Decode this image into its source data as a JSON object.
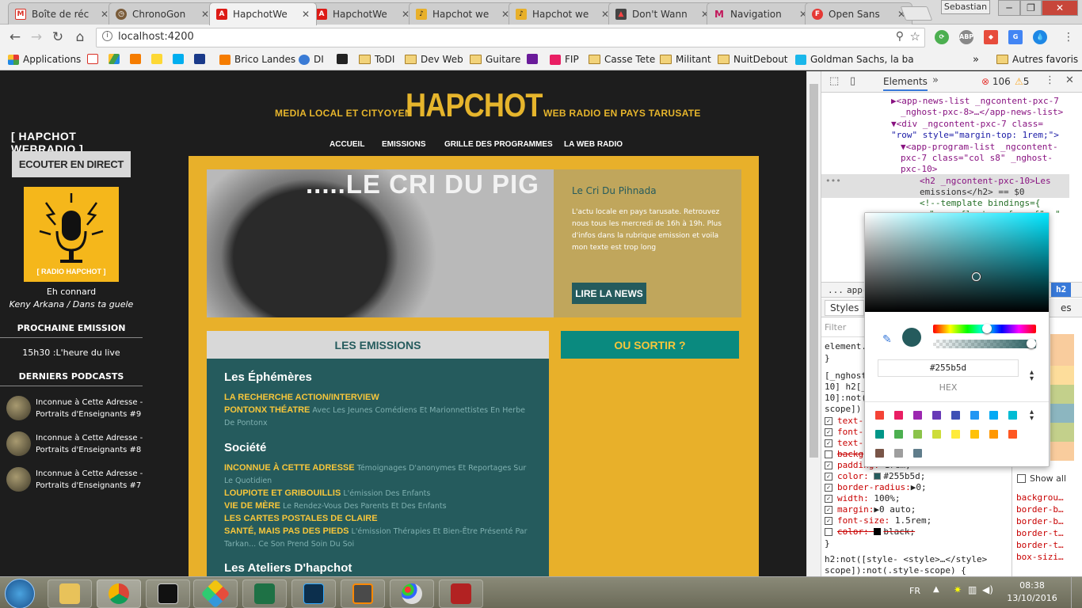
{
  "browser": {
    "tabs": [
      {
        "title": "Boîte de réc",
        "favicon": "gmail-icon",
        "color": "#d93025"
      },
      {
        "title": "ChronoGon",
        "favicon": "chrono-icon",
        "color": "#7a5c3a"
      },
      {
        "title": "HapchotWe",
        "favicon": "angular-icon",
        "color": "#dd1b16"
      },
      {
        "title": "HapchotWe",
        "favicon": "angular-icon",
        "color": "#dd1b16"
      },
      {
        "title": "Hapchot we",
        "favicon": "mic-icon",
        "color": "#e8b02a"
      },
      {
        "title": "Hapchot we",
        "favicon": "mic-icon",
        "color": "#e8b02a"
      },
      {
        "title": "Don't Wann",
        "favicon": "chart-icon",
        "color": "#444"
      },
      {
        "title": "Navigation",
        "favicon": "m-icon",
        "color": "#c2185b"
      },
      {
        "title": "Open Sans",
        "favicon": "f-icon",
        "color": "#e53935"
      }
    ],
    "active_tab": 2,
    "user": "Sebastian",
    "url": "localhost:4200",
    "bookmarks": [
      {
        "label": "Applications",
        "type": "apps"
      },
      {
        "label": "",
        "type": "gmail"
      },
      {
        "label": "",
        "type": "drive"
      },
      {
        "label": "",
        "type": "box"
      },
      {
        "label": "",
        "type": "mc"
      },
      {
        "label": "",
        "type": "blabla"
      },
      {
        "label": "",
        "type": "upr"
      },
      {
        "label": "Brico Landes",
        "type": "box"
      },
      {
        "label": "DI",
        "type": "globe"
      },
      {
        "label": "",
        "type": "zt"
      },
      {
        "label": "ToDI",
        "type": "folder"
      },
      {
        "label": "Dev Web",
        "type": "folder"
      },
      {
        "label": "Guitare",
        "type": "folder"
      },
      {
        "label": "",
        "type": "mail"
      },
      {
        "label": "FIP",
        "type": "fip"
      },
      {
        "label": "Casse Tete",
        "type": "folder"
      },
      {
        "label": "Militant",
        "type": "folder"
      },
      {
        "label": "NuitDebout",
        "type": "folder"
      },
      {
        "label": "Goldman Sachs, la ba",
        "type": "vimeo"
      },
      {
        "label": "Autres favoris",
        "type": "folder"
      }
    ]
  },
  "site": {
    "sidebar": {
      "title": "[ HAPCHOT WEBRADIO ]",
      "listen_button": "ECOUTER EN DIRECT",
      "logo_label": "[ RADIO HAPCHOT ]",
      "now_playing_title": "Eh connard",
      "now_playing_artist": "Keny Arkana / Dans ta guele",
      "next_heading": "PROCHAINE EMISSION",
      "next_show": "15h30 :L'heure du live",
      "podcasts_heading": "DERNIERS PODCASTS",
      "podcasts": [
        "Inconnue à Cette Adresse - Portraits d'Enseignants #9",
        "Inconnue à Cette Adresse - Portraits d'Enseignants #8",
        "Inconnue à Cette Adresse - Portraits d'Enseignants #7"
      ]
    },
    "header": {
      "tagline_left": "MEDIA LOCAL ET CITYOYEN",
      "title": "HAPCHOT",
      "tagline_right": "WEB RADIO EN PAYS TARUSATE"
    },
    "menu": [
      "ACCUEIL",
      "EMISSIONS",
      "GRILLE DES PROGRAMMES",
      "LA WEB RADIO"
    ],
    "news": {
      "image_caption": ".....LE CRI DU PIG",
      "title": "Le Cri Du Pihnada",
      "description": "L'actu locale en pays tarusate. Retrouvez nous tous les mercredi de 16h à 19h. Plus d'infos dans la rubrique emission et voila mon texte est trop long",
      "button": "LIRE LA NEWS"
    },
    "emissions": {
      "heading": "LES EMISSIONS",
      "categories": [
        {
          "name": "Les Éphémères",
          "programs": [
            {
              "name": "LA RECHERCHE ACTION/INTERVIEW",
              "desc": ""
            },
            {
              "name": "PONTONX THÉATRE",
              "desc": "Avec Les Jeunes Comédiens Et Marionnettistes En Herbe De Pontonx"
            }
          ]
        },
        {
          "name": "Société",
          "programs": [
            {
              "name": "INCONNUE À CETTE ADRESSE",
              "desc": "Témoignages D'anonymes Et Reportages Sur Le Quotidien"
            },
            {
              "name": "LOUPIOTE ET GRIBOUILLIS",
              "desc": "L'émission Des Enfants"
            },
            {
              "name": "VIE DE MÈRE",
              "desc": "Le Rendez-Vous Des Parents Et Des Enfants"
            },
            {
              "name": "LES CARTES POSTALES DE CLAIRE",
              "desc": ""
            },
            {
              "name": "SANTÉ, MAIS PAS DES PIEDS",
              "desc": "L'émission Thérapies Et Bien-Être Présenté Par Tarkan... Ce Son Prend Soin Du Soi"
            }
          ]
        },
        {
          "name": "Les Ateliers D'hapchot",
          "programs": []
        }
      ]
    },
    "out_heading": "OU SORTIR ?"
  },
  "devtools": {
    "tab": "Elements",
    "errors": "106",
    "warnings": "5",
    "dom_lines": [
      "▶<app-news-list _ngcontent-pxc-7",
      "_nghost-pxc-8>…</app-news-list>",
      "▼<div _ngcontent-pxc-7 class=",
      "\"row\" style=\"margin-top: 1rem;\">",
      "▼<app-program-list _ngcontent-",
      "pxc-7 class=\"col s8\" _nghost-",
      "pxc-10>",
      "<h2 _ngcontent-pxc-10>Les",
      "emissions</h2> == $0",
      "<!--template bindings={",
      "\"ng-reflect-ng-for-of\": \""
    ],
    "breadcrumb_start": "...",
    "breadcrumb_item": "app-",
    "breadcrumb_end": "h2",
    "styles_tab": "Styles",
    "computed_tab_frag": "es",
    "filter_placeholder": "Filter",
    "show_all": "Show all",
    "element_style": "element.",
    "selector_lines": [
      "[_nghost",
      "10] h2[_",
      "10]:not(",
      "scope]) {"
    ],
    "properties": [
      {
        "name": "text-",
        "value": "",
        "checked": true,
        "struck": false
      },
      {
        "name": "font-",
        "value": "",
        "checked": true,
        "struck": false
      },
      {
        "name": "text-",
        "value": "",
        "checked": true,
        "struck": false
      },
      {
        "name": "backg",
        "value": "",
        "checked": false,
        "struck": true
      },
      {
        "name": "padding:",
        "value": "1rem;",
        "checked": true,
        "struck": false
      },
      {
        "name": "color:",
        "value": "#255b5d;",
        "checked": true,
        "struck": false
      },
      {
        "name": "border-radius:",
        "value": "▶0;",
        "checked": true,
        "struck": false
      },
      {
        "name": "width:",
        "value": "100%;",
        "checked": true,
        "struck": false
      },
      {
        "name": "margin:",
        "value": "▶0 auto;",
        "checked": true,
        "struck": false
      },
      {
        "name": "font-size:",
        "value": "1.5rem;",
        "checked": true,
        "struck": false
      },
      {
        "name": "color:",
        "value": "black;",
        "checked": false,
        "struck": true
      }
    ],
    "next_rule": "h2:not([style-   <style>…</style>",
    "next_rule2": "scope]):not(.style-scope) {",
    "computed_props": [
      "backgrou…",
      "border-b…",
      "border-b…",
      "border-t…",
      "border-t…",
      "box-sizi…"
    ],
    "picker": {
      "hex": "#255b5d",
      "mode": "HEX",
      "current_color": "#255b5d",
      "palette": [
        "#f44336",
        "#e91e63",
        "#9c27b0",
        "#673ab7",
        "#3f51b5",
        "#2196f3",
        "#03a9f4",
        "#00bcd4",
        "#009688",
        "#4caf50",
        "#8bc34a",
        "#cddc39",
        "#ffeb3b",
        "#ffc107",
        "#ff9800",
        "#ff5722",
        "#795548",
        "#9e9e9e",
        "#607d8b"
      ]
    }
  },
  "taskbar": {
    "lang": "FR",
    "time": "08:38",
    "date": "13/10/2016",
    "apps": [
      "explorer-icon",
      "chrome-icon",
      "cmd-icon",
      "git-icon",
      "excel-icon",
      "photoshop-icon",
      "sublime-icon",
      "paint-icon",
      "filezilla-icon"
    ]
  }
}
